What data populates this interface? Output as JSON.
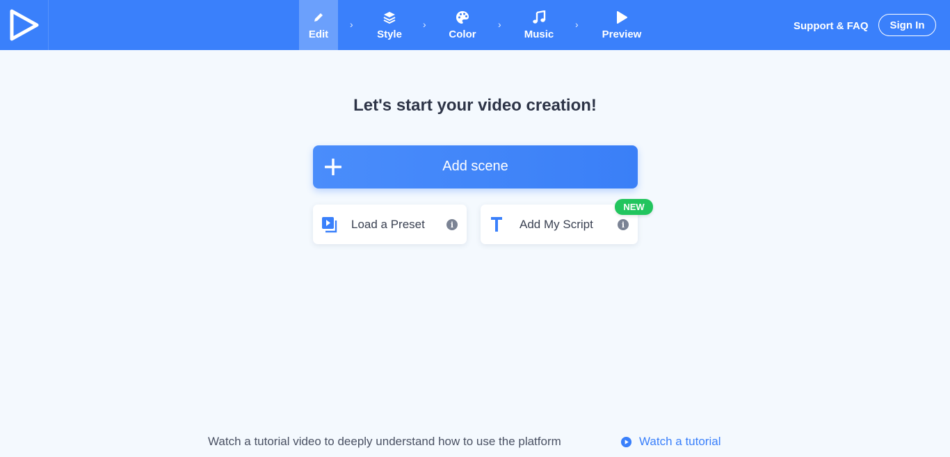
{
  "topbar": {
    "logo_icon": "play-triangle-logo-icon",
    "steps": [
      {
        "label": "Edit",
        "icon": "pencil-icon",
        "active": true
      },
      {
        "label": "Style",
        "icon": "layers-icon",
        "active": false
      },
      {
        "label": "Color",
        "icon": "palette-icon",
        "active": false
      },
      {
        "label": "Music",
        "icon": "music-note-icon",
        "active": false
      },
      {
        "label": "Preview",
        "icon": "play-icon",
        "active": false
      }
    ],
    "separator": "›",
    "support_label": "Support & FAQ",
    "signin_label": "Sign In"
  },
  "main": {
    "headline": "Let's start your video creation!",
    "add_scene_label": "Add scene",
    "load_preset_label": "Load a Preset",
    "add_script_label": "Add My Script",
    "new_badge": "NEW",
    "info_glyph": "i"
  },
  "footer": {
    "text": "Watch a tutorial video to deeply understand how to use the platform",
    "link_label": "Watch a tutorial"
  },
  "colors": {
    "primary": "#3a80fb",
    "background": "#f4f9fe",
    "new_badge": "#22c55e"
  }
}
